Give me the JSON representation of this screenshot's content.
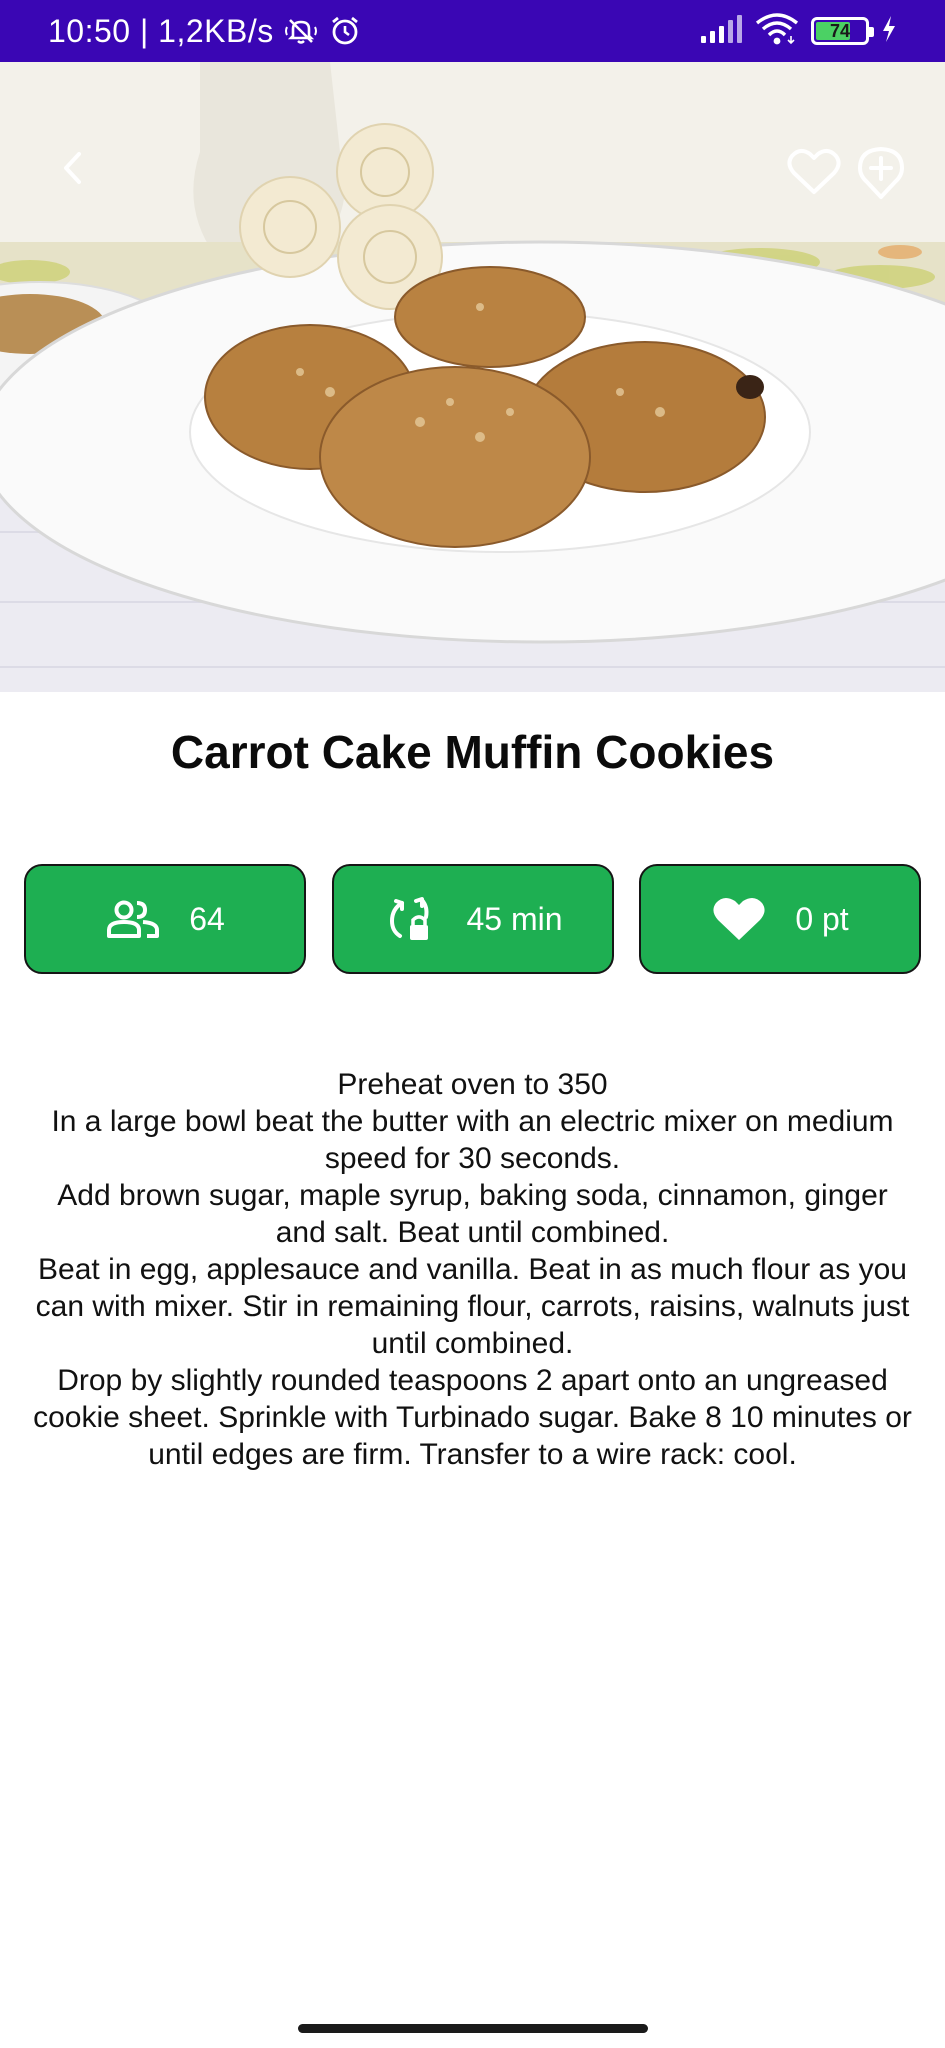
{
  "status_bar": {
    "time_speed": "10:50 | 1,2KB/s",
    "battery_level": "74",
    "battery_percent": 74,
    "background_color": "#3a06b4",
    "icons": [
      "mute-icon",
      "alarm-icon",
      "signal-icon",
      "wifi-icon",
      "battery-icon",
      "charging-icon"
    ]
  },
  "hero": {
    "back_icon": "chevron-left-icon",
    "favorite_icon": "heart-outline-icon",
    "add_icon": "add-circle-icon"
  },
  "recipe": {
    "title": "Carrot Cake Muffin Cookies",
    "stats": [
      {
        "icon": "people-icon",
        "value": "64"
      },
      {
        "icon": "timer-icon",
        "value": "45 min"
      },
      {
        "icon": "heart-icon",
        "value": "0 pt"
      }
    ],
    "accent_color": "#1eaf52",
    "directions": [
      "Preheat oven to 350",
      "In a large bowl beat the butter with an electric mixer on medium speed for 30 seconds.",
      "Add brown sugar, maple syrup, baking soda, cinnamon, ginger and salt. Beat until combined.",
      "Beat in egg, applesauce and vanilla. Beat in as much flour as you can with mixer. Stir in remaining flour, carrots, raisins, walnuts just until combined.",
      "Drop by slightly rounded teaspoons 2 apart onto an ungreased cookie sheet. Sprinkle with Turbinado sugar. Bake 8  10 minutes or until edges are firm. Transfer to a wire rack: cool."
    ]
  }
}
